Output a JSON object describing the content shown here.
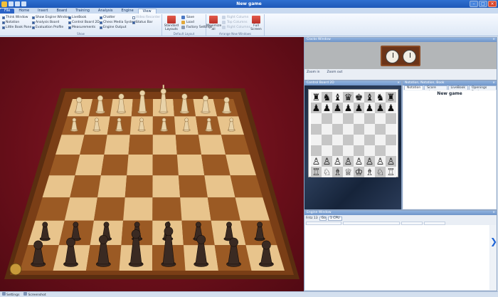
{
  "window": {
    "title": "New game"
  },
  "tabs": [
    "File",
    "Home",
    "Insert",
    "Board",
    "Training",
    "Analysis",
    "Engine",
    "View"
  ],
  "active_tab": "View",
  "ribbon": {
    "windows_group": {
      "title": "Show",
      "items": [
        {
          "label": "Think Window",
          "checked": true
        },
        {
          "label": "Notation",
          "checked": true
        },
        {
          "label": "Little Book Pane",
          "checked": true
        },
        {
          "label": "Show Engine Window",
          "checked": true
        },
        {
          "label": "Analysis Board",
          "checked": true
        },
        {
          "label": "Evaluation Profile",
          "checked": true
        },
        {
          "label": "LiveBook",
          "checked": true
        },
        {
          "label": "Control Board 2D",
          "checked": true
        },
        {
          "label": "Measurements",
          "checked": true
        },
        {
          "label": "Chatter",
          "checked": true
        },
        {
          "label": "Chess Media System",
          "checked": true
        },
        {
          "label": "Engine Output",
          "checked": true
        },
        {
          "label": "Status Bar",
          "checked": true
        },
        {
          "label": "Video Recorder",
          "checked": false
        }
      ]
    },
    "layout_group": {
      "title": "Default Layout",
      "standard_label": "Standard Layouts",
      "save_label": "Save",
      "load_label": "Load",
      "factory_label": "Factory Settings"
    },
    "engine_group": {
      "title": "Arrange New Windows",
      "maximize_label": "Maximize all",
      "right_label": "Right Column",
      "top_label": "Top Columns",
      "bottom_label": "Right Columns",
      "fullscreen_label": "Full Screen"
    }
  },
  "clock_panel": {
    "title": "Clocks Window",
    "link1": "Zoom in",
    "link2": "Zoom out"
  },
  "board_panel": {
    "title": "Control Board 2D"
  },
  "notation_panel": {
    "title": "Notation, Notation, Book",
    "tabs": [
      "Notation",
      "Score sheet",
      "LiveBook",
      "Openings Book"
    ],
    "game_title": "New game"
  },
  "engine_panel": {
    "title": "Engine Window",
    "engine_label": "Fritz 13",
    "buttons": [
      "Go",
      "1 CPU"
    ]
  },
  "statusbar": {
    "items": [
      "Settings",
      "Screenshot"
    ]
  },
  "colors": {
    "accent": "#1d58b8",
    "board_light": "#e8c48c",
    "board_dark": "#9b5a24",
    "felt": "#6a0f1a"
  }
}
